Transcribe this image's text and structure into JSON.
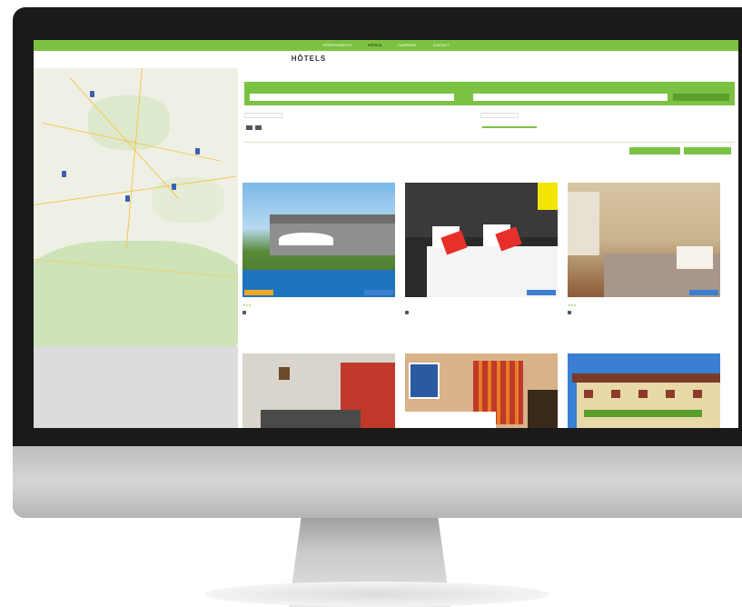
{
  "nav": {
    "items": [
      "HÉBERGEMENTS",
      "HÔTELS",
      "CAMPINGS",
      "CONTACT"
    ],
    "active_index": 1
  },
  "page": {
    "title": "HÔTELS",
    "intro": ""
  },
  "search": {
    "label": "",
    "destination_placeholder": "",
    "or_label": "",
    "second_placeholder": "",
    "submit_label": ""
  },
  "filters": {
    "price_label": "",
    "category_label": "",
    "accommodation_label": "",
    "services_label": "",
    "sort_label": "",
    "sort_value": ""
  },
  "buttons": {
    "reset": "",
    "search": ""
  },
  "results_text": "",
  "hotels": [
    {
      "name": "",
      "stars": "★★★",
      "badge_left": "",
      "price": ""
    },
    {
      "name": "",
      "stars": "",
      "badge_left": "",
      "price": ""
    },
    {
      "name": "",
      "stars": "★★★",
      "badge_left": "",
      "price": ""
    },
    {
      "name": "",
      "stars": "",
      "badge_left": "",
      "price": ""
    },
    {
      "name": "",
      "stars": "",
      "badge_left": "",
      "price": ""
    },
    {
      "name": "",
      "stars": "",
      "badge_left": "",
      "price": ""
    }
  ],
  "colors": {
    "accent": "#7cc242",
    "accent_dark": "#5a9e2c",
    "map_marker": "#3b5fb5",
    "price_badge": "#3b7fd1",
    "label_badge": "#f5a623"
  },
  "icons": [
    "map-marker-icon",
    "parking-icon"
  ]
}
